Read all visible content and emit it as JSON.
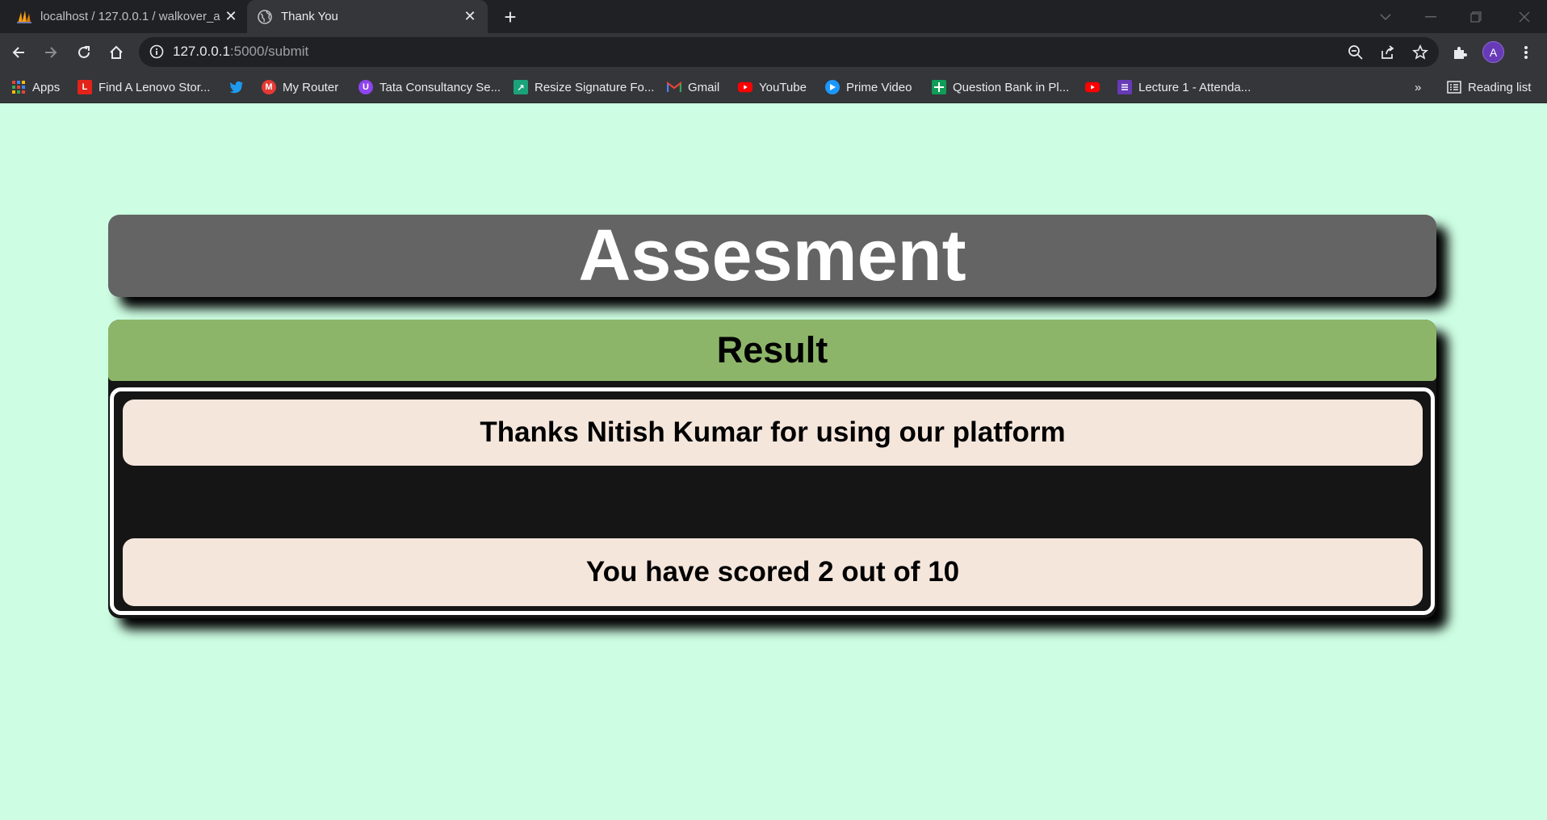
{
  "browser": {
    "tabs": [
      {
        "title": "localhost / 127.0.0.1 / walkover_a",
        "icon": "phpmyadmin-icon",
        "active": false
      },
      {
        "title": "Thank You",
        "icon": "globe-icon",
        "active": true
      }
    ],
    "address": {
      "host": "127.0.0.1",
      "path": ":5000/submit"
    },
    "bookmarks": [
      {
        "label": "Apps",
        "icon": "apps-grid-icon"
      },
      {
        "label": "Find A Lenovo Stor...",
        "icon": "lenovo-icon"
      },
      {
        "label": "",
        "icon": "twitter-icon"
      },
      {
        "label": "My Router",
        "icon": "router-icon"
      },
      {
        "label": "Tata Consultancy Se...",
        "icon": "tcs-icon"
      },
      {
        "label": "Resize Signature Fo...",
        "icon": "resize-icon"
      },
      {
        "label": "Gmail",
        "icon": "gmail-icon"
      },
      {
        "label": "YouTube",
        "icon": "youtube-icon"
      },
      {
        "label": "Prime Video",
        "icon": "prime-video-icon"
      },
      {
        "label": "Question Bank in Pl...",
        "icon": "sheets-icon"
      },
      {
        "label": "",
        "icon": "youtube-icon"
      },
      {
        "label": "Lecture 1 - Attenda...",
        "icon": "forms-icon"
      }
    ],
    "overflow": "»",
    "reading_list": "Reading list",
    "profile_initial": "A"
  },
  "page": {
    "title": "Assesment",
    "result_heading": "Result",
    "thanks_message": "Thanks Nitish Kumar for using our platform",
    "score_message": "You have scored 2 out of 10"
  },
  "colors": {
    "background": "#cdfee3",
    "header": "#646464",
    "result_bar": "#8db569",
    "message_box": "#f5e6dc"
  }
}
